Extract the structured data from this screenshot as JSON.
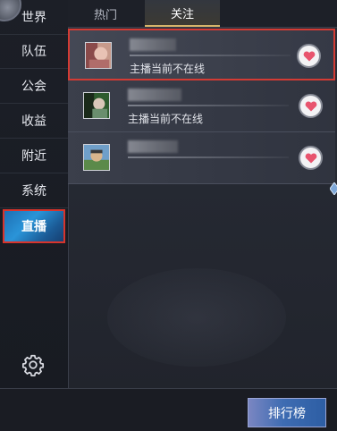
{
  "sidebar": {
    "items": [
      {
        "label": "世界"
      },
      {
        "label": "队伍"
      },
      {
        "label": "公会"
      },
      {
        "label": "收益"
      },
      {
        "label": "附近"
      },
      {
        "label": "系统"
      },
      {
        "label": "直播"
      }
    ],
    "active_index": 6,
    "settings_icon": "gear-icon"
  },
  "tabs": [
    {
      "label": "热门"
    },
    {
      "label": "关注"
    }
  ],
  "active_tab": 1,
  "follow_list": [
    {
      "status": "主播当前不在线",
      "avatar_icon": "avatar-image",
      "follow_icon": "heart-icon"
    },
    {
      "status": "主播当前不在线",
      "avatar_icon": "avatar-image",
      "follow_icon": "heart-icon"
    },
    {
      "status": "",
      "avatar_icon": "avatar-image",
      "follow_icon": "heart-icon"
    }
  ],
  "bottom": {
    "rank_label": "排行榜"
  },
  "colors": {
    "highlight_border": "#d43b34",
    "active_tab_underline": "#d7b56a",
    "heart": "#e8546e",
    "rank_button": "#3e6cb2"
  }
}
